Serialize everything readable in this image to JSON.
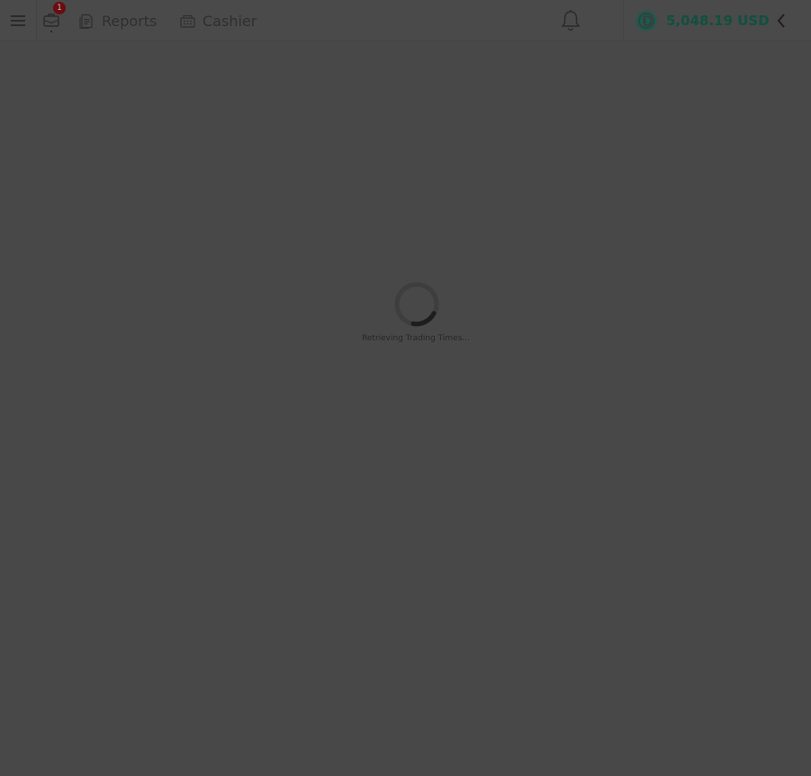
{
  "header": {
    "notification_count": "1",
    "nav": {
      "reports_label": "Reports",
      "cashier_label": "Cashier"
    },
    "account": {
      "balance": "5,048.19 USD",
      "currency_icon": "usd-coin-icon"
    }
  },
  "main": {
    "loading_text": "Retrieving Trading Times..."
  },
  "colors": {
    "overlay_background": "#484848",
    "balance_text": "#11503f",
    "badge": "#6a0d12"
  }
}
